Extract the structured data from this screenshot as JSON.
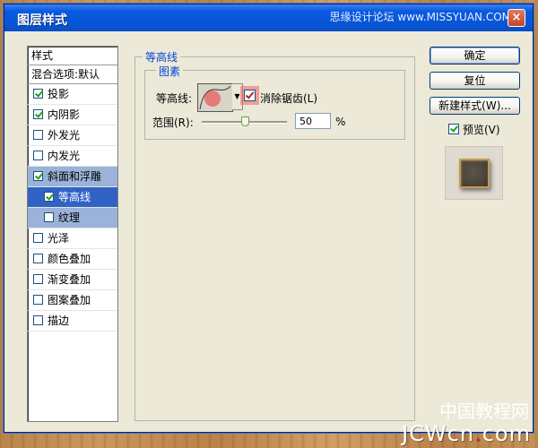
{
  "window": {
    "title": "图层样式",
    "close_label": "×"
  },
  "watermark_top": "思缘设计论坛 www.MISSYUAN.COM",
  "watermark_bottom": {
    "prefix": "中国教程网",
    "site": "JCWcn",
    "dot": ".",
    "tld": "com"
  },
  "sidebar": {
    "header": "样式",
    "blend": "混合选项:默认",
    "items": [
      {
        "label": "投影",
        "checked": true
      },
      {
        "label": "内阴影",
        "checked": true
      },
      {
        "label": "外发光",
        "checked": false
      },
      {
        "label": "内发光",
        "checked": false
      },
      {
        "label": "斜面和浮雕",
        "checked": true
      },
      {
        "label": "等高线",
        "checked": true
      },
      {
        "label": "纹理",
        "checked": false
      },
      {
        "label": "光泽",
        "checked": false
      },
      {
        "label": "颜色叠加",
        "checked": false
      },
      {
        "label": "渐变叠加",
        "checked": false
      },
      {
        "label": "图案叠加",
        "checked": false
      },
      {
        "label": "描边",
        "checked": false
      }
    ]
  },
  "panel": {
    "group_title": "等高线",
    "sub_title": "图素",
    "contour_label": "等高线:",
    "antialias_label": "消除锯齿(L)",
    "antialias_checked": true,
    "range_label": "范围(R):",
    "range_value": "50",
    "range_unit": "%",
    "range_fraction": 0.5
  },
  "buttons": {
    "ok": "确定",
    "reset": "复位",
    "new_style": "新建样式(W)...",
    "preview_label": "预览(V)",
    "preview_checked": true
  },
  "colors": {
    "title_bar": "#0a5ae0",
    "accent_blue": "#0046d5",
    "selected_row": "#3163c5",
    "highlight_row": "#9bb2d9"
  }
}
